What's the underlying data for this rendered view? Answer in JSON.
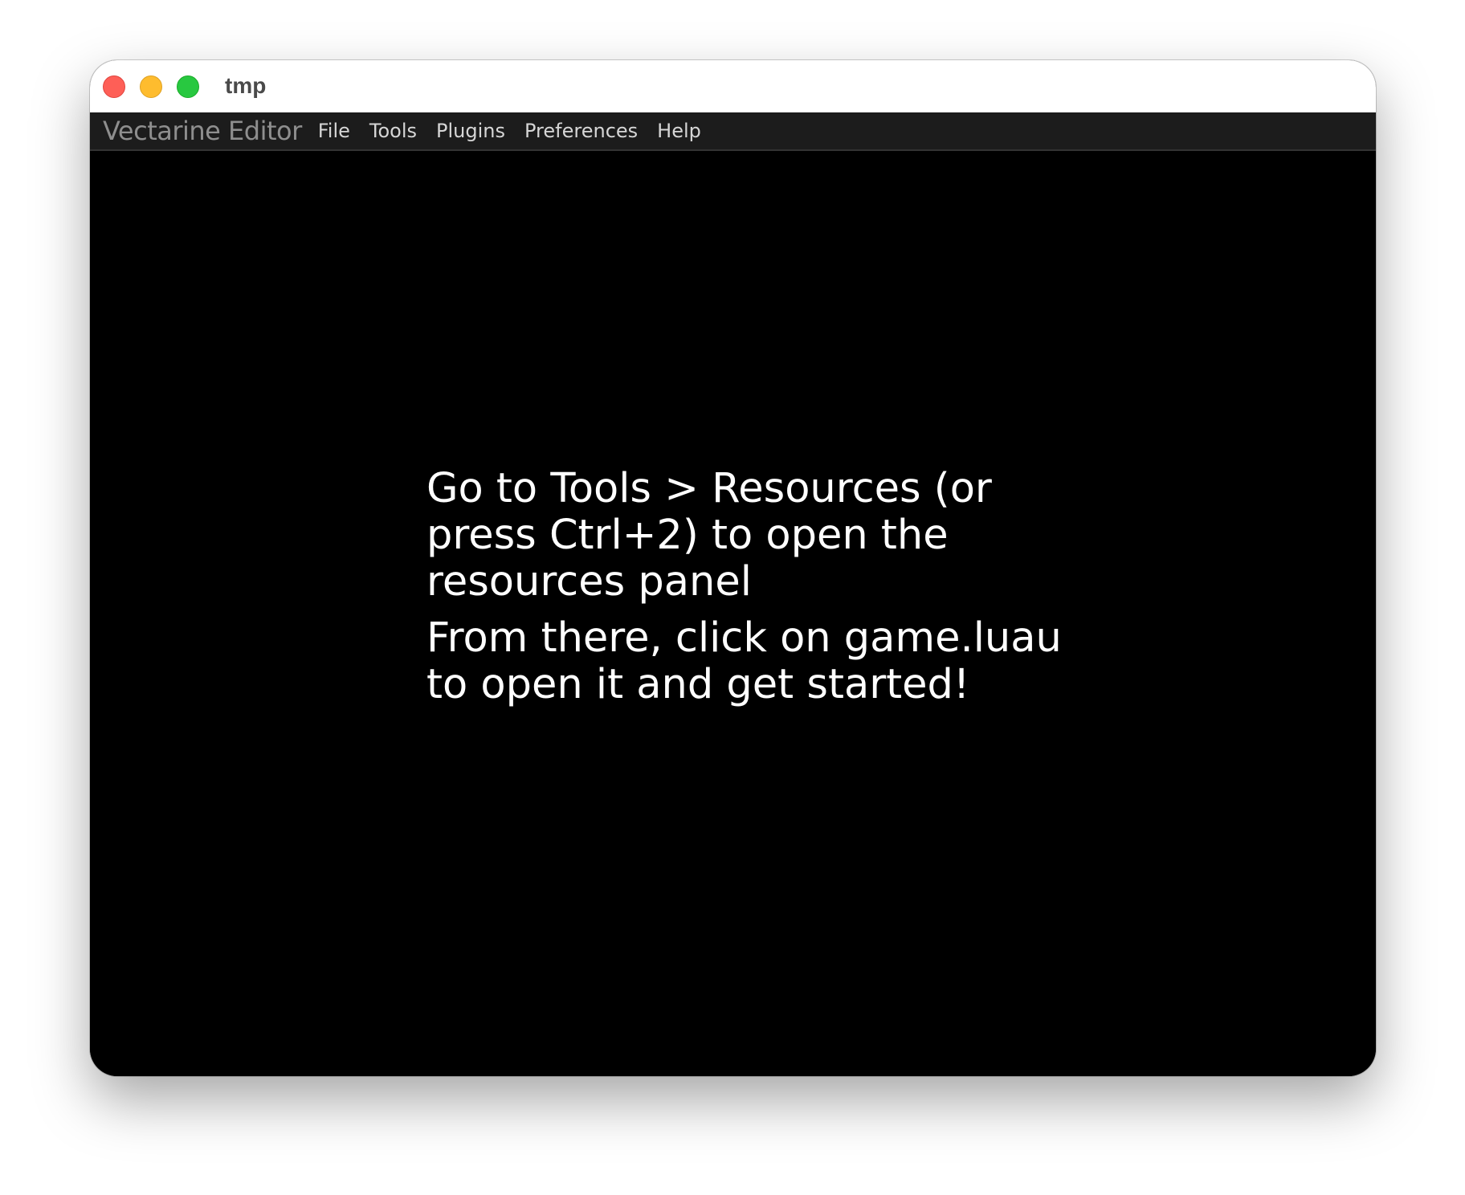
{
  "window": {
    "title": "tmp",
    "buttons": [
      "close",
      "minimize",
      "zoom"
    ]
  },
  "menubar": {
    "app_name": "Vectarine Editor",
    "items": [
      "File",
      "Tools",
      "Plugins",
      "Preferences",
      "Help"
    ]
  },
  "content": {
    "paragraphs": [
      "Go to Tools > Resources (or press Ctrl+2) to open the resources panel",
      "From there, click on game.luau to open it and get started!"
    ]
  },
  "colors": {
    "background": "#000000",
    "menubar": "#1c1c1c",
    "text": "#ffffff",
    "traffic_close": "#fe5f57",
    "traffic_minimize": "#febc2e",
    "traffic_zoom": "#28c840"
  }
}
